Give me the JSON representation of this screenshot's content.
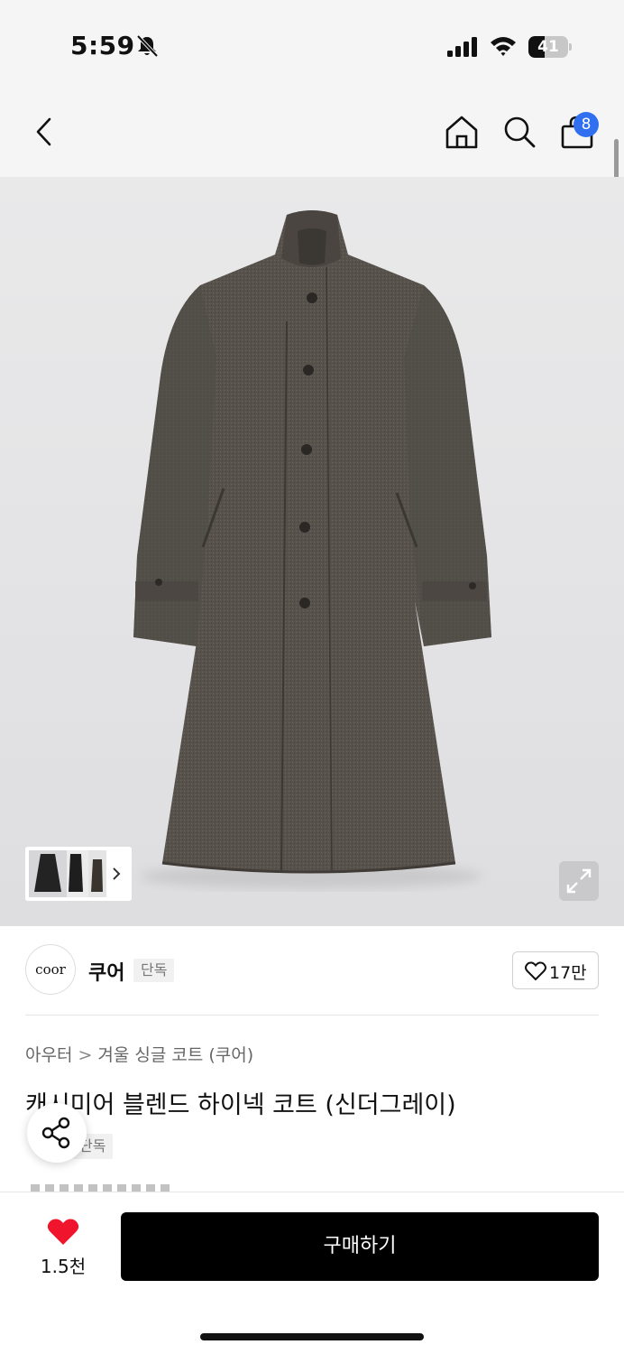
{
  "status_bar": {
    "time": "5:59",
    "battery": "41",
    "battery_level": 0.41
  },
  "header": {
    "cart_count": "8",
    "badge_color": "#2f6ff0"
  },
  "brand": {
    "logo_text": "coor",
    "name": "쿠어",
    "tag": "단독"
  },
  "like": {
    "count": "17만"
  },
  "breadcrumb": {
    "category": "아우터",
    "separator": ">",
    "subcategory": "겨울 싱글 코트 (쿠어)"
  },
  "product": {
    "title": "캐시미어 블렌드 하이넥 코트 (신더그레이)",
    "tag": "단독"
  },
  "bottom": {
    "wish_count": "1.5천",
    "buy_label": "구매하기",
    "heart_color": "#f0142d"
  }
}
